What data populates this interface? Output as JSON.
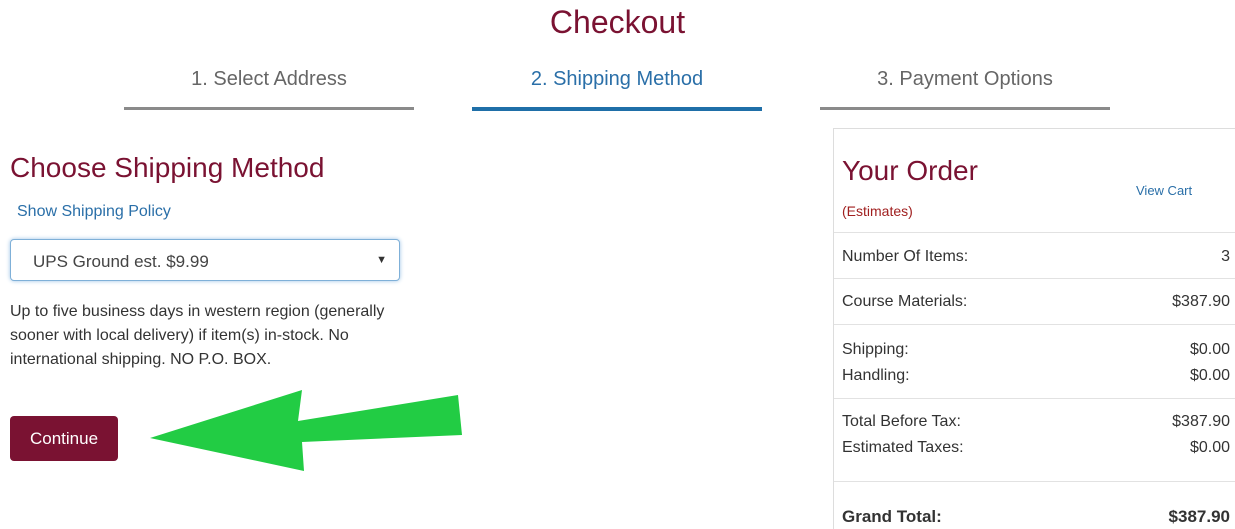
{
  "page": {
    "title": "Checkout"
  },
  "steps": [
    {
      "label": "1. Select Address"
    },
    {
      "label": "2. Shipping Method"
    },
    {
      "label": "3. Payment Options"
    }
  ],
  "shipping": {
    "heading": "Choose Shipping Method",
    "policy_link": "Show Shipping Policy",
    "selected_method": "UPS Ground est. $9.99",
    "description": "Up to five business days in western region (generally sooner with local delivery) if item(s) in-stock. No international shipping. NO P.O. BOX.",
    "continue_label": "Continue"
  },
  "order": {
    "title": "Your Order",
    "view_cart": "View Cart",
    "estimates": "(Estimates)",
    "items_label": "Number Of Items:",
    "items_value": "3",
    "materials_label": "Course Materials:",
    "materials_value": "$387.90",
    "shipping_label": "Shipping:",
    "shipping_value": "$0.00",
    "handling_label": "Handling:",
    "handling_value": "$0.00",
    "before_tax_label": "Total Before Tax:",
    "before_tax_value": "$387.90",
    "taxes_label": "Estimated Taxes:",
    "taxes_value": "$0.00",
    "grand_total_label": "Grand Total:",
    "grand_total_value": "$387.90"
  },
  "colors": {
    "brand": "#7a1232",
    "link": "#2a6fa8",
    "annotation_arrow": "#22cc44"
  },
  "icons": {
    "select_caret": "dropdown-caret-icon",
    "annotation": "green-arrow-icon"
  }
}
